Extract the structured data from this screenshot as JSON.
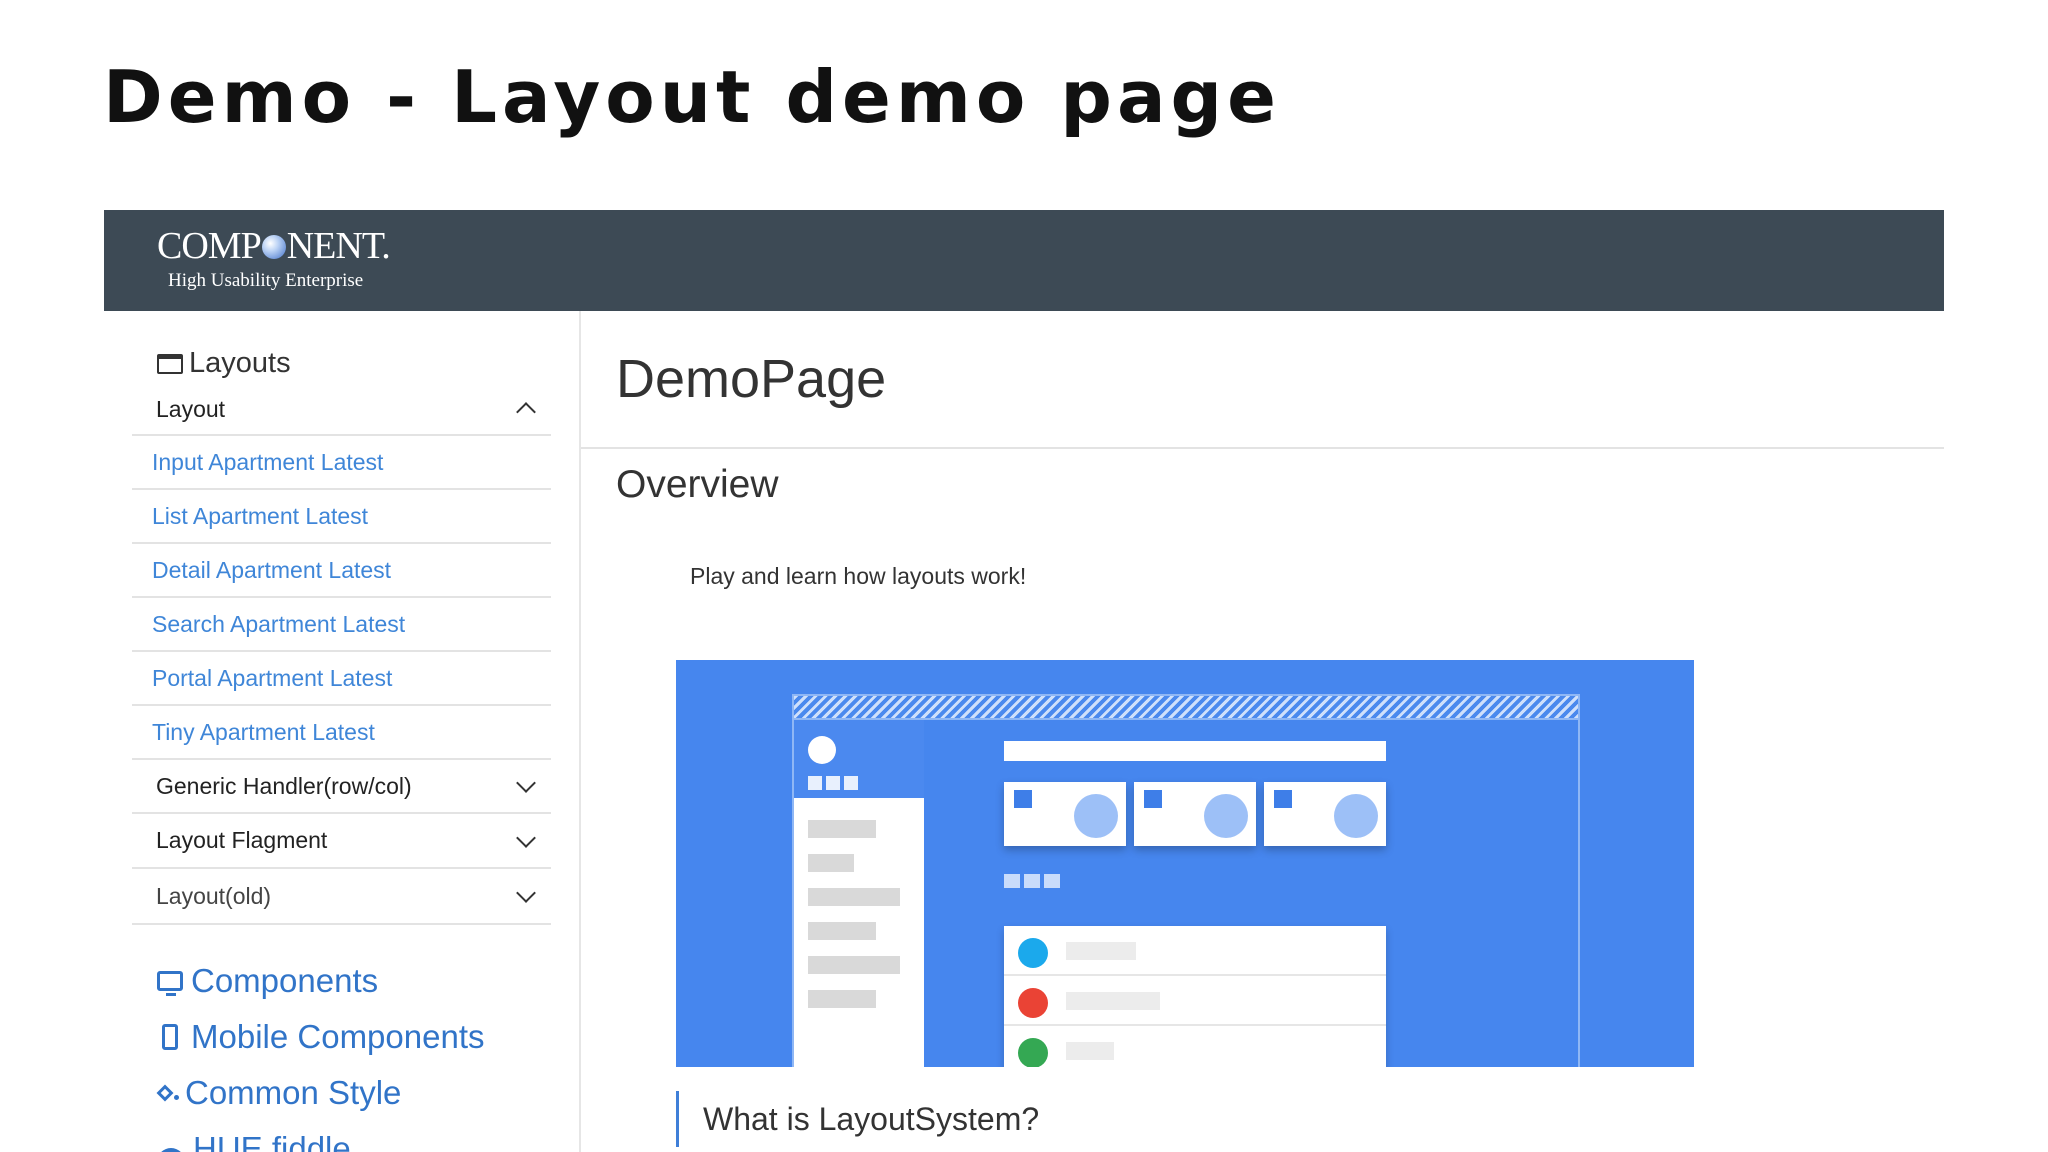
{
  "slide": {
    "title": "Demo - Layout demo page"
  },
  "header": {
    "logo_left": "COMP",
    "logo_right": "NENT.",
    "logo_tagline": "High Usability Enterprise"
  },
  "sidebar": {
    "layouts_heading": "Layouts",
    "group_layout": "Layout",
    "links": [
      "Input Apartment Latest",
      "List Apartment Latest",
      "Detail Apartment Latest",
      "Search Apartment Latest",
      "Portal Apartment Latest",
      "Tiny Apartment Latest"
    ],
    "groups": [
      "Generic Handler(row/col)",
      "Layout Flagment",
      "Layout(old)"
    ],
    "nav": [
      "Components",
      "Mobile Components",
      "Common Style",
      "HUE fiddle"
    ]
  },
  "main": {
    "page_title": "DemoPage",
    "section_title": "Overview",
    "overview_text": "Play and learn how layouts work!",
    "callout": "What is LayoutSystem?"
  },
  "colors": {
    "header_bg": "#3d4a55",
    "link": "#3f86d8",
    "nav_link": "#3174c8",
    "illustration_bg": "#4686ee"
  }
}
